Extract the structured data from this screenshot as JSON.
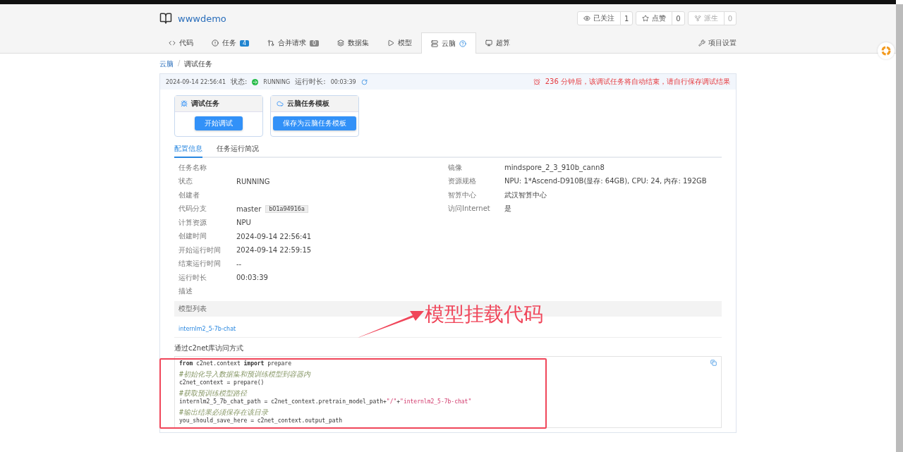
{
  "repo": {
    "name": "wwwdemo",
    "actions": [
      {
        "kind": "watch",
        "label": "已关注",
        "count": "1",
        "disabled": false
      },
      {
        "kind": "star",
        "label": "点赞",
        "count": "0",
        "disabled": false
      },
      {
        "kind": "fork",
        "label": "派生",
        "count": "0",
        "disabled": true
      }
    ]
  },
  "tabs": [
    {
      "kind": "code",
      "label": "代码",
      "selected": false
    },
    {
      "kind": "issue",
      "label": "任务",
      "badge": "4",
      "selected": false
    },
    {
      "kind": "pr",
      "label": "合并请求",
      "badge": "0",
      "selected": false
    },
    {
      "kind": "dataset",
      "label": "数据集",
      "selected": false
    },
    {
      "kind": "model",
      "label": "模型",
      "selected": false
    },
    {
      "kind": "cloud",
      "label": "云脑",
      "selected": true
    },
    {
      "kind": "compute",
      "label": "超算",
      "selected": false
    }
  ],
  "settings": "项目设置",
  "breadcrumb": {
    "items": [
      "云脑",
      "调试任务"
    ],
    "separator": "/"
  },
  "task_bar": {
    "created": "2024-09-14 22:56:41",
    "status_label": "状态:",
    "status": "RUNNING",
    "duration_label": "运行时长:",
    "duration": "00:03:39",
    "warning": "236 分钟后，该调试任务将自动结束，请自行保存调试结果"
  },
  "cards": [
    {
      "kind": "debug",
      "title": "调试任务",
      "button": "开始调试"
    },
    {
      "kind": "template",
      "title": "云脑任务模板",
      "button": "保存为云脑任务模板"
    }
  ],
  "detail_tabs": [
    {
      "label": "配置信息",
      "selected": true
    },
    {
      "label": "任务运行简况",
      "selected": false
    }
  ],
  "left_fields": [
    {
      "label": "任务名称"
    },
    {
      "label": "状态",
      "value": "RUNNING"
    },
    {
      "label": "创建者"
    },
    {
      "label": "代码分支",
      "value": "master",
      "tag": "b01a94916a"
    },
    {
      "label": "计算资源",
      "value": "NPU"
    },
    {
      "label": "创建时间",
      "value": "2024-09-14 22:56:41"
    },
    {
      "label": "开始运行时间",
      "value": "2024-09-14 22:59:15"
    },
    {
      "label": "结束运行时间",
      "value": "--"
    },
    {
      "label": "运行时长",
      "value": "00:03:39"
    },
    {
      "label": "描述"
    }
  ],
  "right_fields": [
    {
      "label": "镜像",
      "value": "mindspore_2_3_910b_cann8"
    },
    {
      "label": "资源规格",
      "value": "NPU: 1*Ascend-D910B(显存: 64GB), CPU: 24, 内存: 192GB"
    },
    {
      "label": "智算中心",
      "value": "武汉智算中心"
    },
    {
      "label": "访问Internet",
      "value": "是"
    }
  ],
  "model_list": {
    "header": "模型列表",
    "items": [
      "internlm2_5-7b-chat"
    ]
  },
  "access": {
    "title": "通过c2net库访问方式",
    "code": [
      [
        [
          {
            "kind": "keyword",
            "text": "from"
          },
          {
            "kind": "plain",
            "text": " c2net.context "
          },
          {
            "kind": "keyword",
            "text": "import"
          },
          {
            "kind": "plain",
            "text": " prepare"
          }
        ]
      ],
      [
        [
          {
            "kind": "comment",
            "text": "#初始化导入数据集和预训练模型到容器内"
          }
        ],
        [
          {
            "kind": "plain",
            "text": "c2net_context = prepare()"
          }
        ]
      ],
      [
        [
          {
            "kind": "comment",
            "text": "#获取预训练模型路径"
          }
        ],
        [
          {
            "kind": "plain",
            "text": "internlm2_5_7b_chat_path = c2net_context.pretrain_model_path+"
          },
          {
            "kind": "string",
            "text": "\"/\""
          },
          {
            "kind": "plain",
            "text": "+"
          },
          {
            "kind": "string",
            "text": "\"internlm2_5-7b-chat\""
          }
        ]
      ],
      [
        [
          {
            "kind": "comment",
            "text": "#输出结果必须保存在该目录"
          }
        ],
        [
          {
            "kind": "plain",
            "text": "you_should_save_here = c2net_context.output_path"
          }
        ]
      ]
    ]
  },
  "annotation": {
    "text": "模型挂载代码"
  }
}
